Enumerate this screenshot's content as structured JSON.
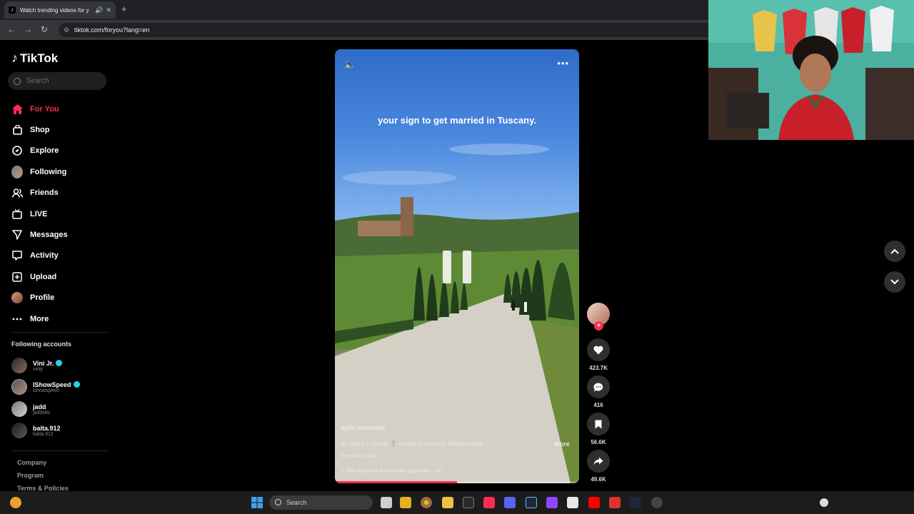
{
  "browser": {
    "tab_title": "Watch trending videos for y",
    "url": "tiktok.com/foryou?lang=en",
    "new_tab_icon": "plus-icon"
  },
  "sidebar": {
    "logo_text": "TikTok",
    "search_placeholder": "Search",
    "nav": [
      {
        "label": "For You",
        "icon": "home-icon",
        "active": true
      },
      {
        "label": "Shop",
        "icon": "bag-icon"
      },
      {
        "label": "Explore",
        "icon": "compass-icon"
      },
      {
        "label": "Following",
        "icon": "following-avatar"
      },
      {
        "label": "Friends",
        "icon": "friends-icon"
      },
      {
        "label": "LIVE",
        "icon": "live-icon"
      },
      {
        "label": "Messages",
        "icon": "send-icon"
      },
      {
        "label": "Activity",
        "icon": "inbox-icon"
      },
      {
        "label": "Upload",
        "icon": "upload-icon"
      },
      {
        "label": "Profile",
        "icon": "profile-avatar"
      },
      {
        "label": "More",
        "icon": "dots-icon"
      }
    ],
    "following_title": "Following accounts",
    "accounts": [
      {
        "name": "Vini Jr.",
        "handle": "vinijr",
        "verified": true
      },
      {
        "name": "IShowSpeed",
        "handle": "ishowspeed",
        "verified": true
      },
      {
        "name": "jadd",
        "handle": "jaddsito",
        "verified": false
      },
      {
        "name": "balta.912",
        "handle": "balta.912",
        "verified": false
      }
    ],
    "footer": [
      "Company",
      "Program",
      "Terms & Policies"
    ]
  },
  "video": {
    "caption": "your sign to get married in Tuscany.",
    "author": "aylin.molinaaa",
    "description": "So glad it's sunday 🌷 #toskana #tuscany #italywedding...",
    "more_label": "more",
    "see_translation": "See translation",
    "music": "♫  the world we knew over and over - mi",
    "progress": 0.5
  },
  "actions": {
    "likes": "423.7K",
    "comments": "416",
    "saves": "56.6K",
    "shares": "49.6K"
  },
  "taskbar": {
    "search_label": "Search"
  },
  "colors": {
    "accent": "#fe2c55",
    "verified": "#20d5ec",
    "background": "#000000"
  }
}
